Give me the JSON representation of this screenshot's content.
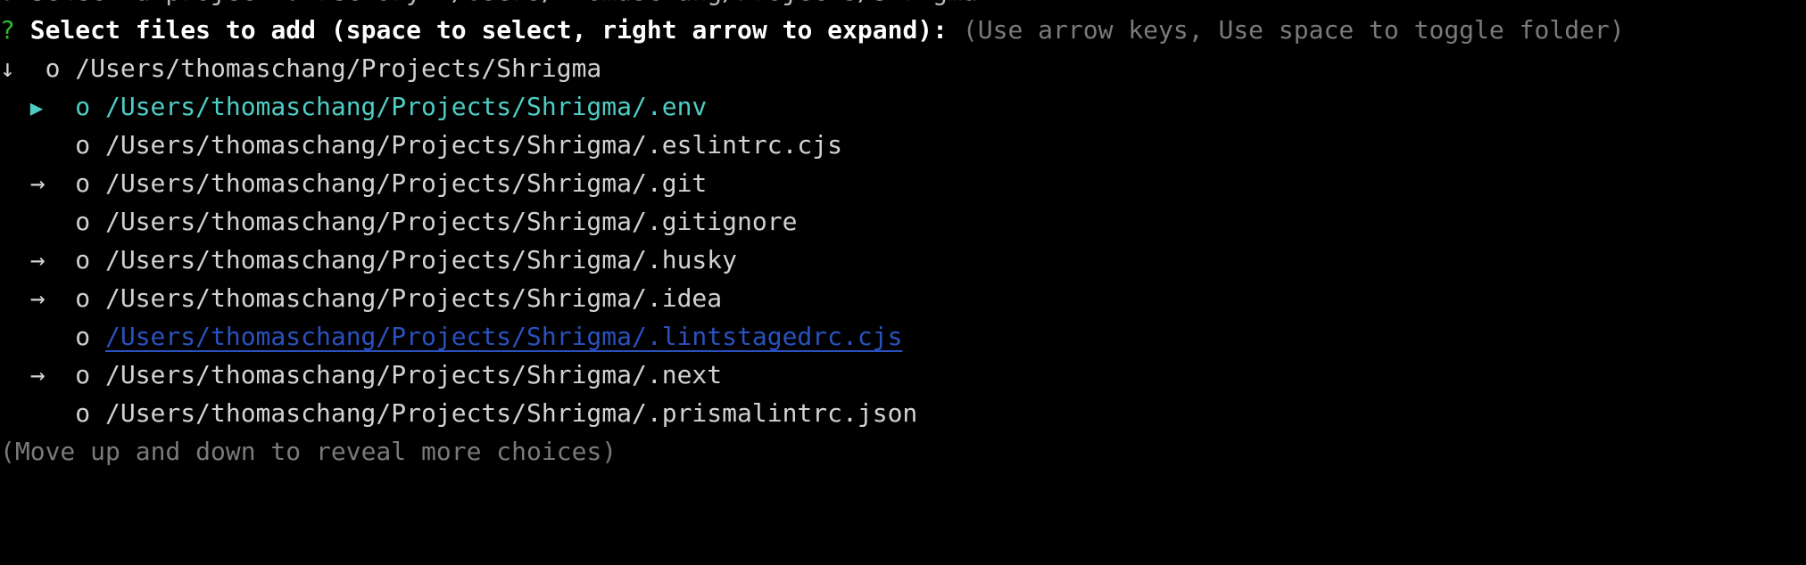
{
  "terminal": {
    "background_color": "#000000",
    "foreground_color": "#d2d2d2",
    "clipped_top_line": "? Select a project directory: /Users/thomaschang/Projects/Shrigma"
  },
  "prompt": {
    "marker": "?",
    "marker_color": "#2dbd2d",
    "message": "Select files to add (space to select, right arrow to expand):",
    "hint": "(Use arrow keys, Use space to toggle folder)",
    "hint_color": "#7a7a7a"
  },
  "tree": {
    "selected_index": 1,
    "selected_color": "#4ecdc4",
    "link_color": "#2a52be",
    "rows": [
      {
        "prefix": "↓",
        "prefix_type": "arrow-down-icon",
        "checkbox": "o",
        "label": "/Users/thomaschang/Projects/Shrigma",
        "indent": 0,
        "state": "expanded-root",
        "is_directory": true,
        "selected": false,
        "linked": false
      },
      {
        "prefix": "▶",
        "prefix_type": "triangle-right-icon",
        "checkbox": "o",
        "label": "/Users/thomaschang/Projects/Shrigma/.env",
        "indent": 1,
        "state": "cursor",
        "is_directory": false,
        "selected": true,
        "linked": false
      },
      {
        "prefix": " ",
        "prefix_type": "none",
        "checkbox": "o",
        "label": "/Users/thomaschang/Projects/Shrigma/.eslintrc.cjs",
        "indent": 1,
        "state": "file",
        "is_directory": false,
        "selected": false,
        "linked": false
      },
      {
        "prefix": "→",
        "prefix_type": "arrow-right-icon",
        "checkbox": "o",
        "label": "/Users/thomaschang/Projects/Shrigma/.git",
        "indent": 1,
        "state": "collapsed-folder",
        "is_directory": true,
        "selected": false,
        "linked": false
      },
      {
        "prefix": " ",
        "prefix_type": "none",
        "checkbox": "o",
        "label": "/Users/thomaschang/Projects/Shrigma/.gitignore",
        "indent": 1,
        "state": "file",
        "is_directory": false,
        "selected": false,
        "linked": false
      },
      {
        "prefix": "→",
        "prefix_type": "arrow-right-icon",
        "checkbox": "o",
        "label": "/Users/thomaschang/Projects/Shrigma/.husky",
        "indent": 1,
        "state": "collapsed-folder",
        "is_directory": true,
        "selected": false,
        "linked": false
      },
      {
        "prefix": "→",
        "prefix_type": "arrow-right-icon",
        "checkbox": "o",
        "label": "/Users/thomaschang/Projects/Shrigma/.idea",
        "indent": 1,
        "state": "collapsed-folder",
        "is_directory": true,
        "selected": false,
        "linked": false
      },
      {
        "prefix": " ",
        "prefix_type": "none",
        "checkbox": "o",
        "label": "/Users/thomaschang/Projects/Shrigma/.lintstagedrc.cjs",
        "indent": 1,
        "state": "file-link",
        "is_directory": false,
        "selected": false,
        "linked": true
      },
      {
        "prefix": "→",
        "prefix_type": "arrow-right-icon",
        "checkbox": "o",
        "label": "/Users/thomaschang/Projects/Shrigma/.next",
        "indent": 1,
        "state": "collapsed-folder",
        "is_directory": true,
        "selected": false,
        "linked": false
      },
      {
        "prefix": " ",
        "prefix_type": "none",
        "checkbox": "o",
        "label": "/Users/thomaschang/Projects/Shrigma/.prismalintrc.json",
        "indent": 1,
        "state": "file",
        "is_directory": false,
        "selected": false,
        "linked": false
      }
    ]
  },
  "footer": {
    "text": "(Move up and down to reveal more choices)"
  }
}
